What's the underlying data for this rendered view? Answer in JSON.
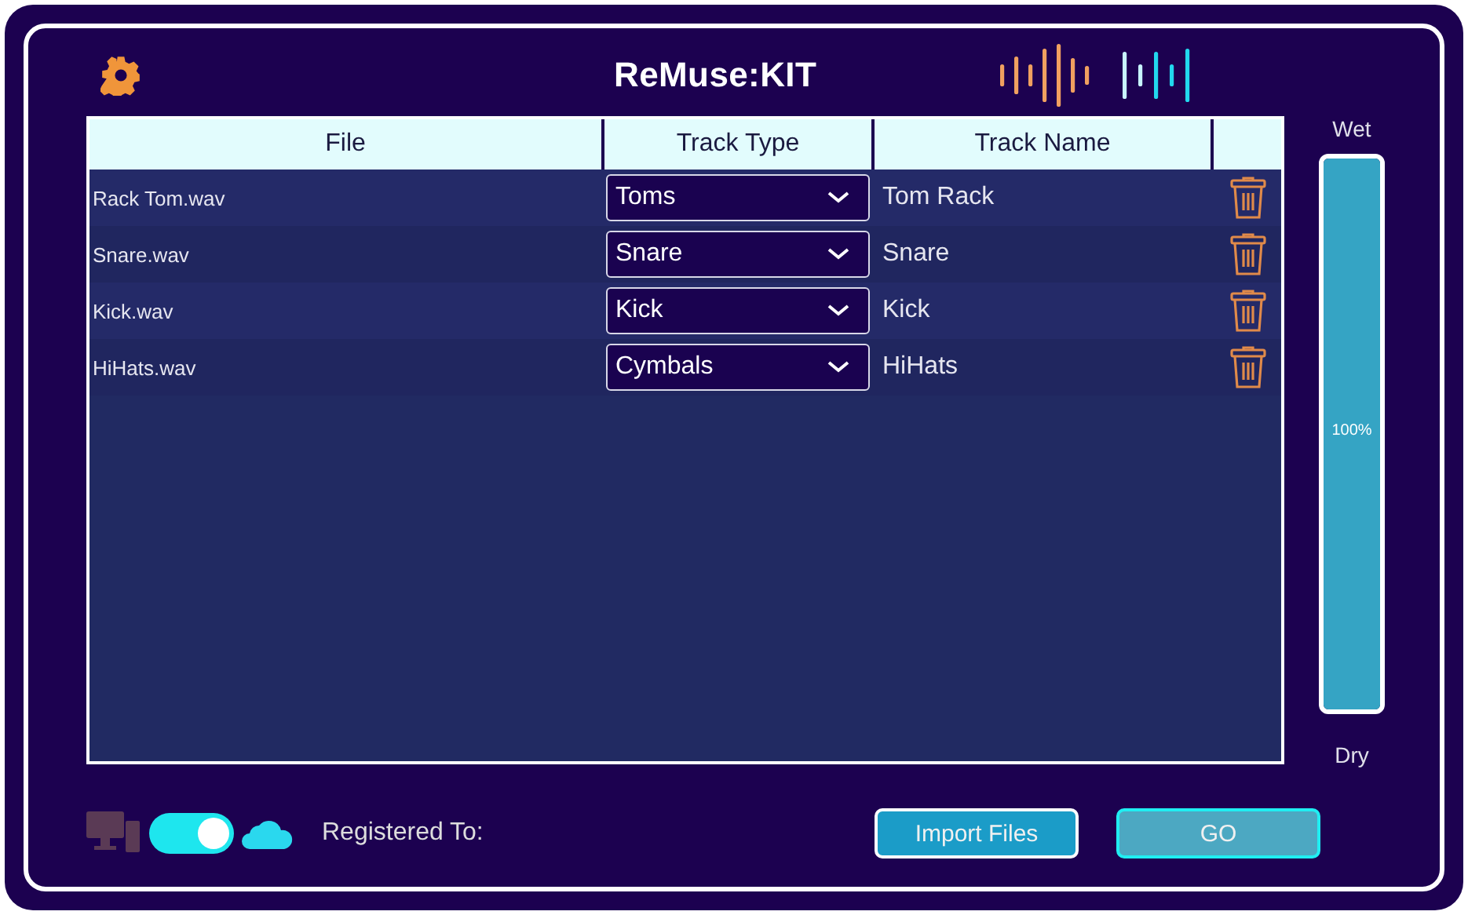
{
  "header": {
    "title": "ReMuse:KIT"
  },
  "table": {
    "columns": [
      "File",
      "Track Type",
      "Track Name"
    ],
    "rows": [
      {
        "file": "Rack Tom.wav",
        "track_type": "Toms",
        "track_name": "Tom Rack"
      },
      {
        "file": "Snare.wav",
        "track_type": "Snare",
        "track_name": "Snare"
      },
      {
        "file": "Kick.wav",
        "track_type": "Kick",
        "track_name": "Kick"
      },
      {
        "file": "HiHats.wav",
        "track_type": "Cymbals",
        "track_name": "HiHats"
      }
    ]
  },
  "mix_slider": {
    "top_label": "Wet",
    "bottom_label": "Dry",
    "reading": "100%",
    "level": 1
  },
  "footer": {
    "cloud_toggle": {
      "on": true
    },
    "registered_label": "Registered To:",
    "buttons": [
      "Import Files",
      "GO"
    ]
  }
}
